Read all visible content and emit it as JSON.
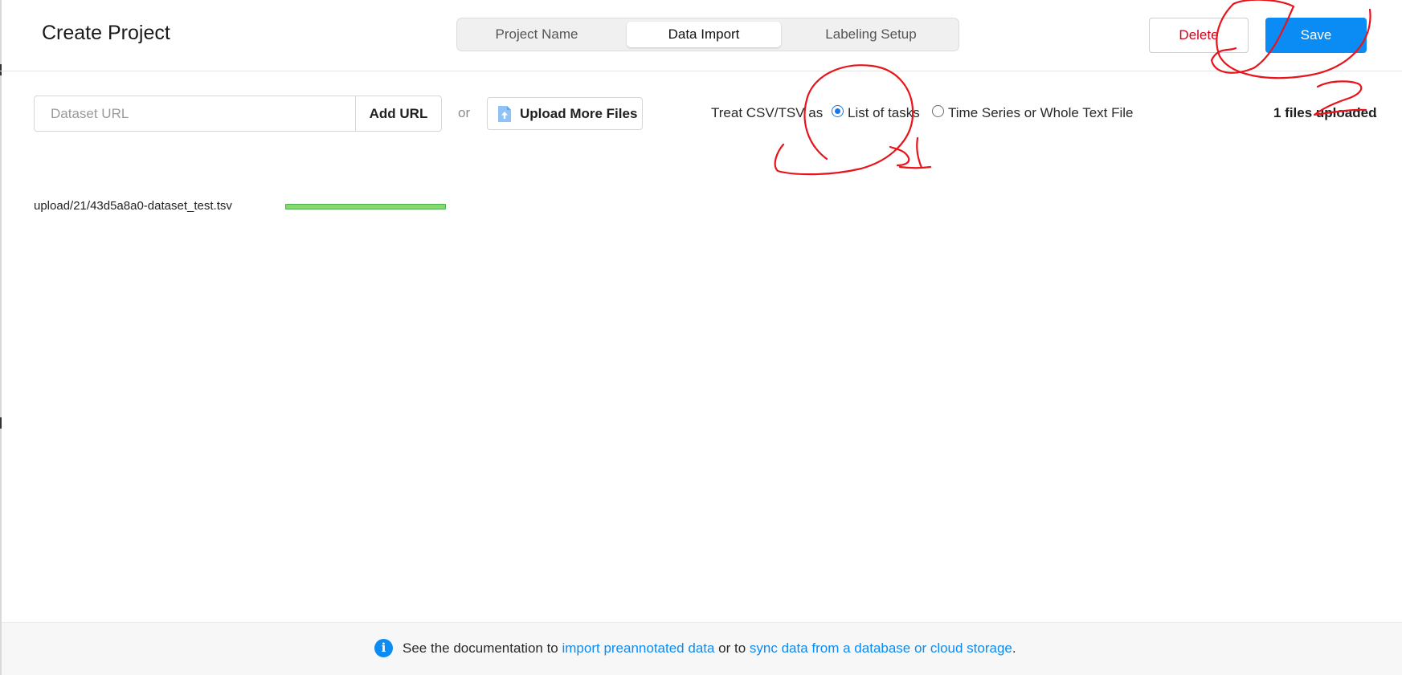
{
  "header": {
    "title": "Create Project",
    "tabs": [
      {
        "label": "Project Name",
        "active": false
      },
      {
        "label": "Data Import",
        "active": true
      },
      {
        "label": "Labeling Setup",
        "active": false
      }
    ],
    "delete_label": "Delete",
    "save_label": "Save"
  },
  "import": {
    "url_placeholder": "Dataset URL",
    "add_url_label": "Add URL",
    "or_label": "or",
    "upload_label": "Upload More Files",
    "treat_label": "Treat CSV/TSV as",
    "radio_options": [
      "List of tasks",
      "Time Series or Whole Text File"
    ],
    "radio_selected": "List of tasks",
    "files_uploaded": "1 files uploaded",
    "files_uploaded_suffix": "."
  },
  "files": [
    {
      "name": "upload/21/43d5a8a0-dataset_test.tsv",
      "progress": 1.0
    }
  ],
  "footer": {
    "prefix": "See the documentation to ",
    "link1": "import preannotated data",
    "middle": " or to ",
    "link2": "sync data from a database or cloud storage",
    "suffix": "."
  },
  "colors": {
    "accent": "#0b8cf5",
    "danger": "#d0021b",
    "progress": "#86d86a",
    "annotation": "#e8141c"
  },
  "annotations": {
    "labels": [
      "1",
      "2"
    ]
  }
}
